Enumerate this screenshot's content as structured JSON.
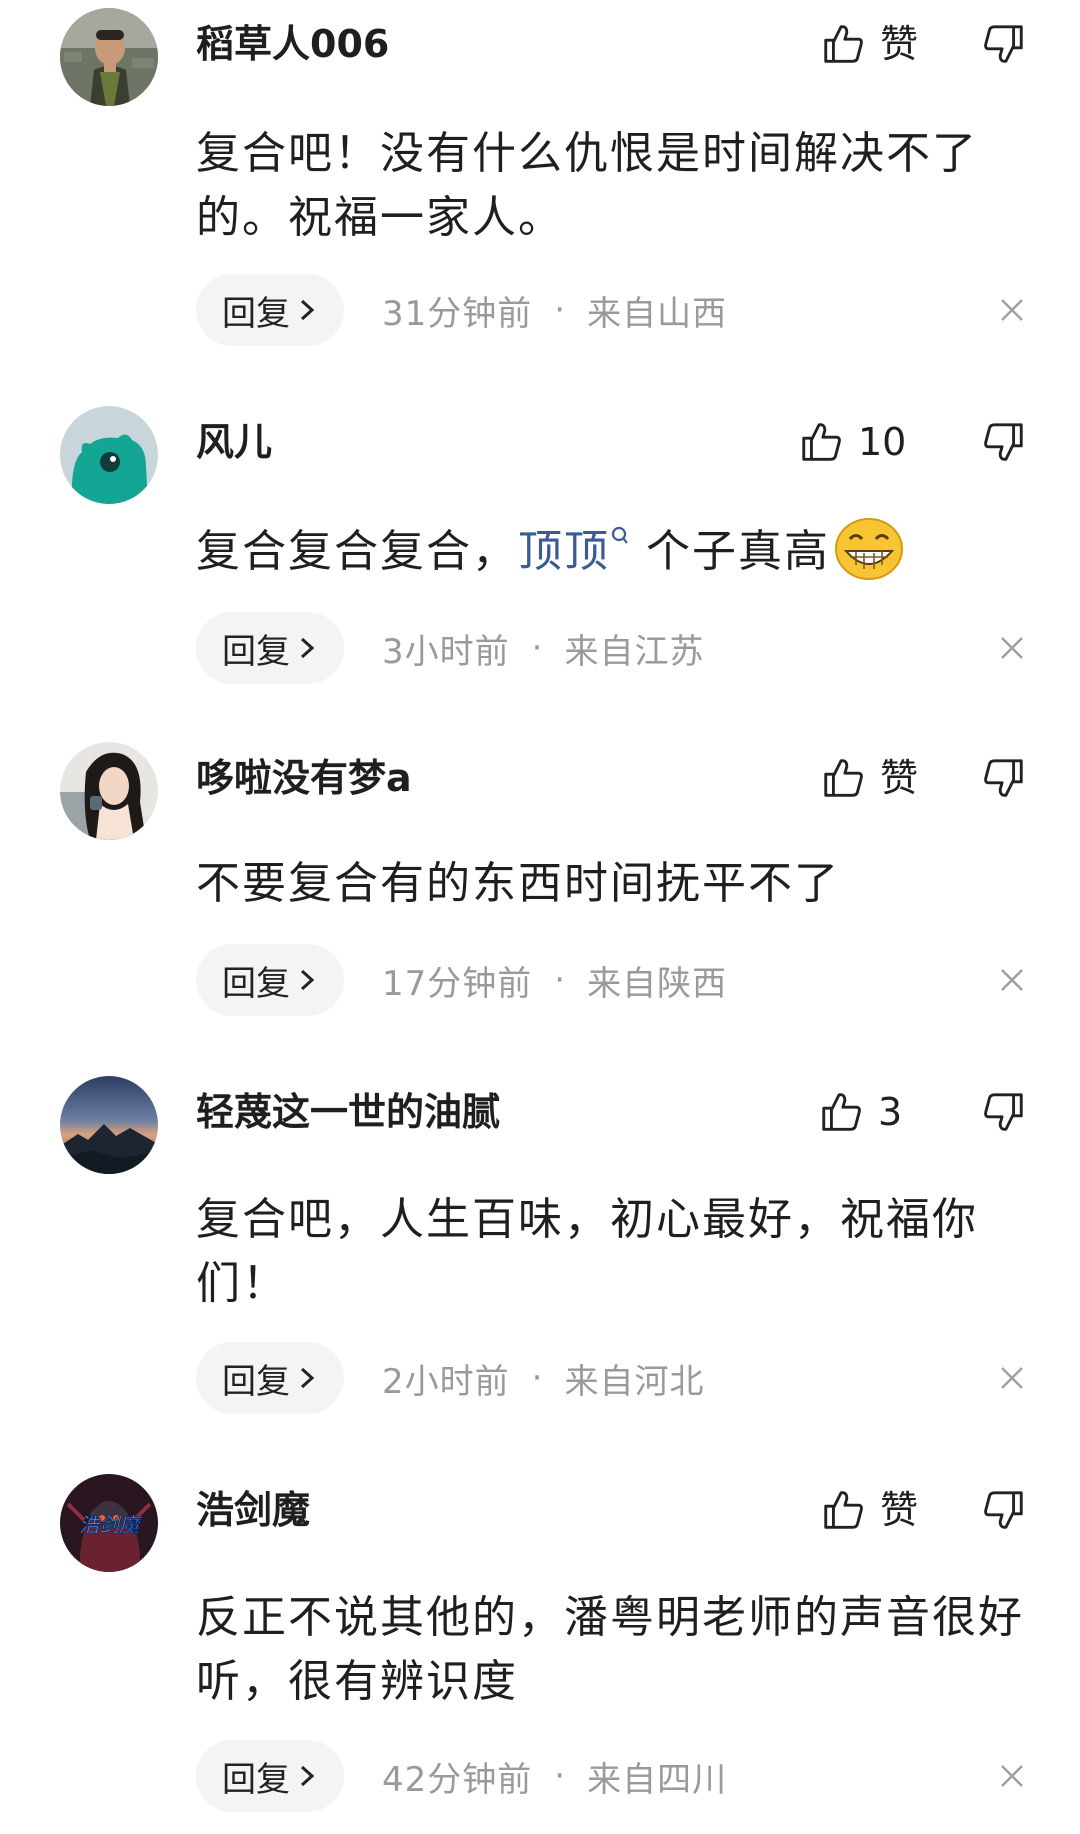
{
  "comments": [
    {
      "username": "稻草人006",
      "like_label": "赞",
      "text": "复合吧！没有什么仇恨是时间解决不了的。祝福一家人。",
      "reply_label": "回复",
      "time": "31分钟前",
      "location": "来自山西",
      "avatar": "boy-photo-avatar"
    },
    {
      "username": "风儿",
      "like_label": "10",
      "text_before": "复合复合复合，",
      "topic": "顶顶",
      "text_after": "个子真高",
      "reply_label": "回复",
      "time": "3小时前",
      "location": "来自江苏",
      "avatar": "teal-creature-avatar",
      "emoji": "grinning-emoji"
    },
    {
      "username": "哆啦没有梦a",
      "like_label": "赞",
      "text": "不要复合有的东西时间抚平不了",
      "reply_label": "回复",
      "time": "17分钟前",
      "location": "来自陕西",
      "avatar": "woman-photo-avatar"
    },
    {
      "username": "轻蔑这一世的油腻",
      "like_label": "3",
      "text": "复合吧，人生百味，初心最好，祝福你们！",
      "reply_label": "回复",
      "time": "2小时前",
      "location": "来自河北",
      "avatar": "mountain-sunset-avatar"
    },
    {
      "username": "浩剑魔",
      "like_label": "赞",
      "text": "反正不说其他的，潘粤明老师的声音很好听，很有辨识度",
      "reply_label": "回复",
      "time": "42分钟前",
      "location": "来自四川",
      "avatar": "game-character-avatar",
      "avatar_text": "浩剑魔"
    }
  ],
  "meta_separator": "·",
  "colors": {
    "text": "#1f1f1f",
    "meta": "#9a9a9a",
    "topic": "#3b5b95",
    "reply_bg": "#f4f4f4"
  }
}
